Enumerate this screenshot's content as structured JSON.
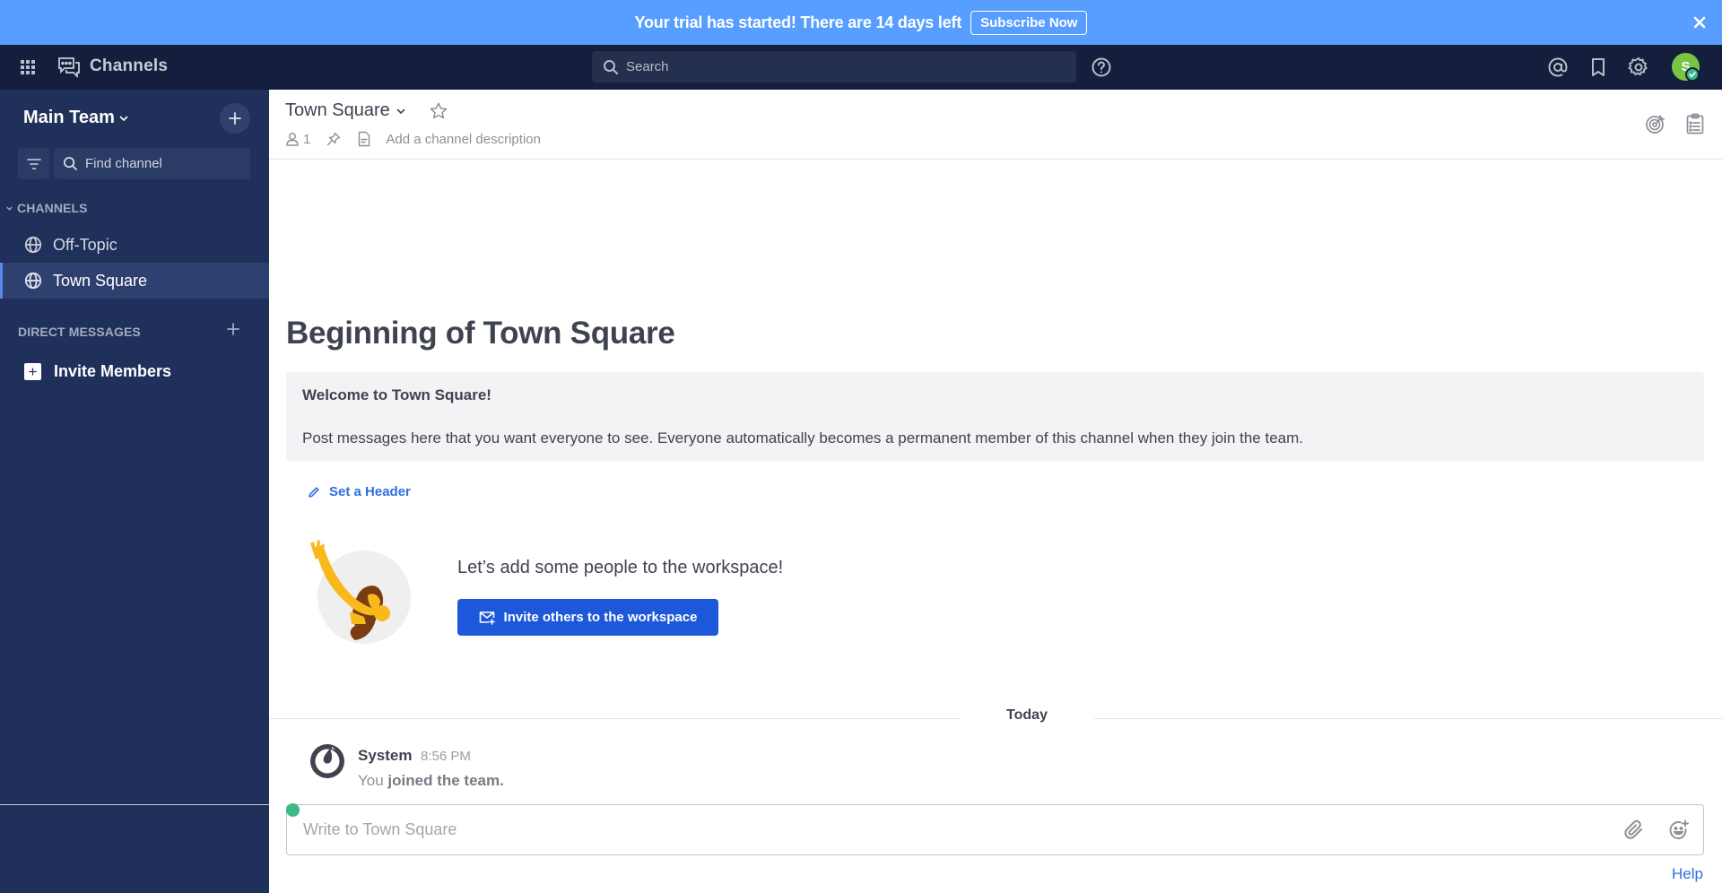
{
  "banner": {
    "message": "Your trial has started! There are 14 days left",
    "button_label": "Subscribe Now",
    "close_icon": "close-icon"
  },
  "global_header": {
    "product_name": "Channels",
    "search_placeholder": "Search",
    "icons": [
      "grid-icon",
      "channels-icon",
      "help-icon",
      "mention-icon",
      "bookmark-icon",
      "gear-icon"
    ],
    "avatar_initial": "S",
    "status": "online"
  },
  "sidebar": {
    "team_name": "Main Team",
    "find_channel_placeholder": "Find channel",
    "channels_section": "CHANNELS",
    "channels": [
      {
        "label": "Off-Topic",
        "icon": "globe-icon",
        "active": false
      },
      {
        "label": "Town Square",
        "icon": "globe-icon",
        "active": true
      }
    ],
    "dm_section": "DIRECT MESSAGES",
    "invite_label": "Invite Members"
  },
  "channel_header": {
    "title": "Town Square",
    "member_count": "1",
    "description_placeholder": "Add a channel description"
  },
  "intro": {
    "title": "Beginning of Town Square",
    "welcome_title": "Welcome to Town Square!",
    "welcome_body": "Post messages here that you want everyone to see. Everyone automatically becomes a permanent member of this channel when they join the team.",
    "set_header_label": "Set a Header",
    "add_people_text": "Let’s add some people to the workspace!",
    "invite_button_label": "Invite others to the workspace"
  },
  "messages": {
    "date_separator": "Today",
    "items": [
      {
        "author": "System",
        "time": "8:56 PM",
        "body_prefix": "You",
        "body_bold": "joined the team."
      }
    ]
  },
  "composer": {
    "placeholder": "Write to Town Square",
    "help_label": "Help"
  },
  "colors": {
    "banner": "#579eff",
    "header": "#151f3d",
    "sidebar": "#1f305a",
    "accent": "#1c58d9",
    "link": "#2c6fde",
    "online": "#3db887"
  }
}
